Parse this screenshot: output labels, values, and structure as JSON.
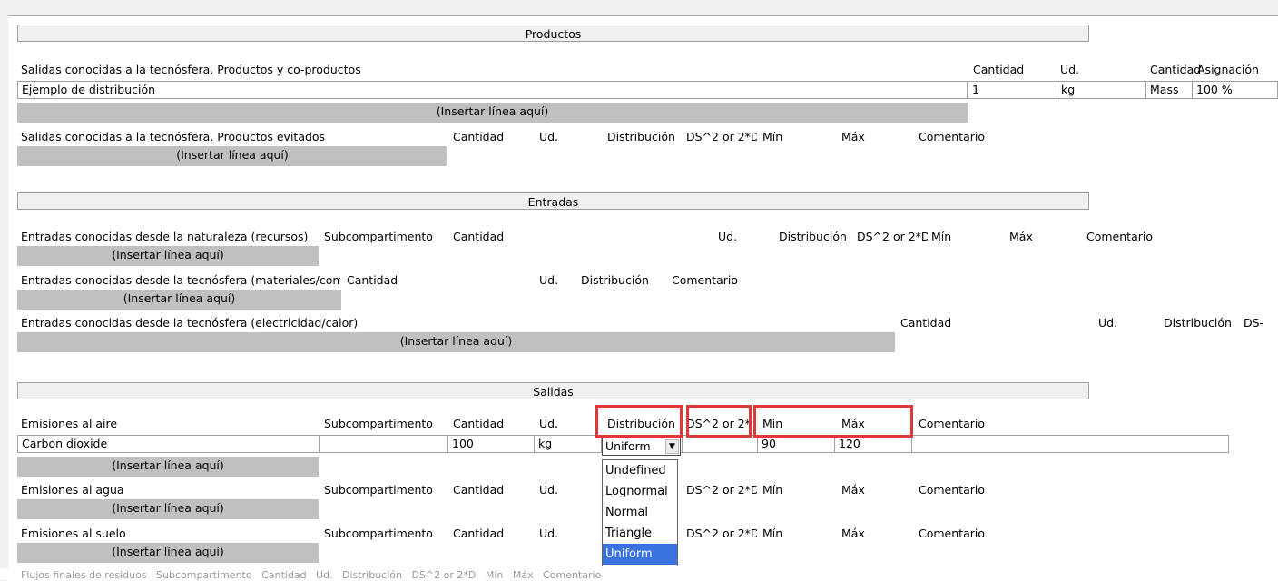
{
  "productos": {
    "header": "Productos",
    "known_outputs": {
      "label": "Salidas conocidas a la tecnósfera. Productos y co-productos",
      "cols": [
        "Cantidad",
        "Ud.",
        "Cantidad",
        "Asignación"
      ],
      "row": {
        "name": "Ejemplo de distribución",
        "cantidad": "1",
        "ud": "kg",
        "cantidad2": "Mass",
        "asignacion": "100 %"
      },
      "insert": "(Insertar línea aquí)"
    },
    "avoided": {
      "label": "Salidas conocidas a la tecnósfera. Productos evitados",
      "cols": [
        "Cantidad",
        "Ud.",
        "Distribución",
        "DS^2 or 2*D",
        "Mín",
        "Máx",
        "Comentario"
      ],
      "insert": "(Insertar línea aquí)"
    }
  },
  "entradas": {
    "header": "Entradas",
    "nature": {
      "label": "Entradas conocidas desde la naturaleza (recursos)",
      "cols": [
        "Subcompartimento",
        "Cantidad",
        "Ud.",
        "Distribución",
        "DS^2 or 2*D",
        "Mín",
        "Máx",
        "Comentario"
      ],
      "insert": "(Insertar línea aquí)"
    },
    "materials": {
      "label": "Entradas conocidas desde la tecnósfera (materiales/com",
      "cols": [
        "Cantidad",
        "Ud.",
        "Distribución",
        "Comentario"
      ],
      "insert": "(Insertar línea aquí)"
    },
    "electricity": {
      "label": "Entradas conocidas desde la tecnósfera (electricidad/calor)",
      "cols": [
        "Cantidad",
        "Ud.",
        "Distribución",
        "DS-"
      ],
      "insert": "(Insertar línea aquí)"
    }
  },
  "salidas": {
    "header": "Salidas",
    "air": {
      "label": "Emisiones al aire",
      "cols": [
        "Subcompartimento",
        "Cantidad",
        "Ud.",
        "Distribución",
        "DS^2 or 2*",
        "Mín",
        "Máx",
        "Comentario"
      ],
      "row": {
        "name": "Carbon dioxide",
        "subcomp": "",
        "cantidad": "100",
        "ud": "kg",
        "distribucion": "Uniform",
        "ds": "",
        "min": "90",
        "max": "120",
        "comentario": ""
      },
      "insert": "(Insertar línea aquí)"
    },
    "water": {
      "label": "Emisiones al agua",
      "cols": [
        "Subcompartimento",
        "Cantidad",
        "Ud.",
        "DS^2 or 2*D",
        "Mín",
        "Máx",
        "Comentario"
      ],
      "insert": "(Insertar línea aquí)"
    },
    "soil": {
      "label": "Emisiones al suelo",
      "cols": [
        "Subcompartimento",
        "Cantidad",
        "Ud.",
        "DS^2 or 2*D",
        "Mín",
        "Máx",
        "Comentario"
      ],
      "insert": "(Insertar línea aquí)"
    },
    "partial_row": "Flujos finales de residuos   Subcompartimento   Cantidad   Ud.   Distribución   DS^2 or 2*D   Mín   Máx   Comentario"
  },
  "dropdown": {
    "options": [
      "Undefined",
      "Lognormal",
      "Normal",
      "Triangle",
      "Uniform"
    ],
    "selected": "Uniform"
  },
  "colors": {
    "highlight": "#e0393a",
    "selection": "#3a72e0",
    "insert_bar": "#c0c0c0"
  }
}
